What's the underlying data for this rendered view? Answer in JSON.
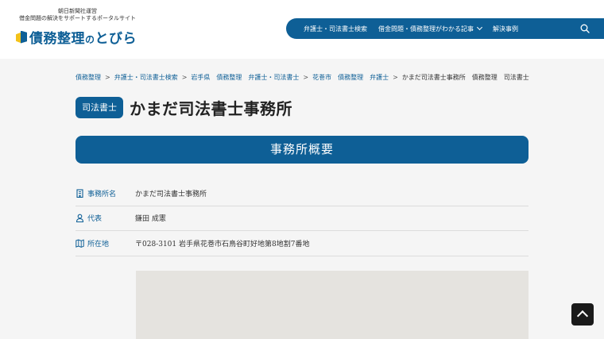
{
  "header": {
    "tagline_line1": "朝日新聞社運営",
    "tagline_line2": "借金問題の解決をサポートするポータルサイト",
    "logo_main": "債務整理",
    "logo_small": "の",
    "logo_tail": "とびら",
    "nav": [
      {
        "label": "弁護士・司法書士検索"
      },
      {
        "label": "借金問題・債務整理がわかる記事"
      },
      {
        "label": "解決事例"
      }
    ],
    "accent_color": "#0e5f96"
  },
  "breadcrumb": [
    {
      "label": "債務整理"
    },
    {
      "label": "弁護士・司法書士検索"
    },
    {
      "label": "岩手県　債務整理　弁護士・司法書士"
    },
    {
      "label": "花巻市　債務整理　弁護士"
    },
    {
      "label": "かまだ司法書士事務所　債務整理　司法書士"
    }
  ],
  "title": {
    "badge": "司法書士",
    "name": "かまだ司法書士事務所"
  },
  "section": {
    "heading": "事務所概要"
  },
  "info": [
    {
      "label": "事務所名",
      "value": "かまだ司法書士事務所",
      "icon": "building-icon"
    },
    {
      "label": "代表",
      "value": "鎌田 成憲",
      "icon": "person-icon"
    },
    {
      "label": "所在地",
      "value": "〒028-3101 岩手県花巻市石鳥谷町好地第8地割7番地",
      "icon": "map-icon"
    }
  ]
}
